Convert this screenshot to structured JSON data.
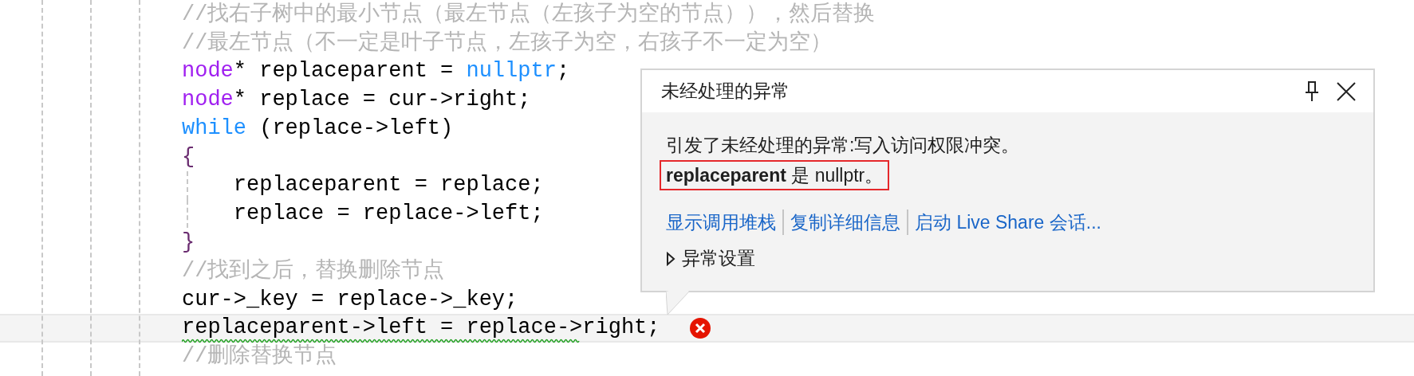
{
  "editor": {
    "lines": [
      {
        "current": false,
        "error": false,
        "tokens": [
          {
            "kind": "comment",
            "text": "//找右子树中的最小节点（最左节点（左孩子为空的节点）），然后替换",
            "squiggle": false
          }
        ]
      },
      {
        "current": false,
        "error": false,
        "tokens": [
          {
            "kind": "comment",
            "text": "//最左节点（不一定是叶子节点，左孩子为空，右孩子不一定为空）",
            "squiggle": false
          }
        ]
      },
      {
        "current": false,
        "error": false,
        "tokens": [
          {
            "kind": "type",
            "text": "node",
            "squiggle": false
          },
          {
            "kind": "plain",
            "text": "* replaceparent = ",
            "squiggle": false
          },
          {
            "kind": "keyword",
            "text": "nullptr",
            "squiggle": false
          },
          {
            "kind": "plain",
            "text": ";",
            "squiggle": false
          }
        ]
      },
      {
        "current": false,
        "error": false,
        "tokens": [
          {
            "kind": "type",
            "text": "node",
            "squiggle": false
          },
          {
            "kind": "plain",
            "text": "* replace = cur->right;",
            "squiggle": false
          }
        ]
      },
      {
        "current": false,
        "error": false,
        "tokens": [
          {
            "kind": "keyword",
            "text": "while",
            "squiggle": false
          },
          {
            "kind": "plain",
            "text": " (replace->left)",
            "squiggle": false
          }
        ]
      },
      {
        "current": false,
        "error": false,
        "tokens": [
          {
            "kind": "brace",
            "text": "{",
            "squiggle": false
          }
        ]
      },
      {
        "current": false,
        "error": false,
        "tokens": [
          {
            "kind": "plain",
            "text": "    replaceparent = replace;",
            "squiggle": false
          }
        ]
      },
      {
        "current": false,
        "error": false,
        "tokens": [
          {
            "kind": "plain",
            "text": "    replace = replace->left;",
            "squiggle": false
          }
        ]
      },
      {
        "current": false,
        "error": false,
        "tokens": [
          {
            "kind": "brace",
            "text": "}",
            "squiggle": false
          }
        ]
      },
      {
        "current": false,
        "error": false,
        "tokens": [
          {
            "kind": "comment",
            "text": "//找到之后，替换删除节点",
            "squiggle": false
          }
        ]
      },
      {
        "current": false,
        "error": false,
        "tokens": [
          {
            "kind": "plain",
            "text": "cur->_key = replace->_key;",
            "squiggle": false
          }
        ]
      },
      {
        "current": true,
        "error": true,
        "tokens": [
          {
            "kind": "plain",
            "text": "replaceparent->left = replace->",
            "squiggle": true
          },
          {
            "kind": "plain",
            "text": "right;",
            "squiggle": false
          }
        ]
      },
      {
        "current": false,
        "error": false,
        "tokens": [
          {
            "kind": "comment",
            "text": "//删除替换节点",
            "squiggle": false
          }
        ]
      }
    ]
  },
  "exception_popup": {
    "title": "未经处理的异常",
    "messages": [
      {
        "text": "引发了未经处理的异常:写入访问权限冲突。",
        "highlighted": false
      },
      {
        "text": "**replaceparent** 是 nullptr。",
        "highlighted": true
      }
    ],
    "links": [
      "显示调用堆栈",
      "复制详细信息",
      "启动 Live Share 会话..."
    ],
    "settings": {
      "label": "异常设置",
      "expanded": false
    }
  }
}
